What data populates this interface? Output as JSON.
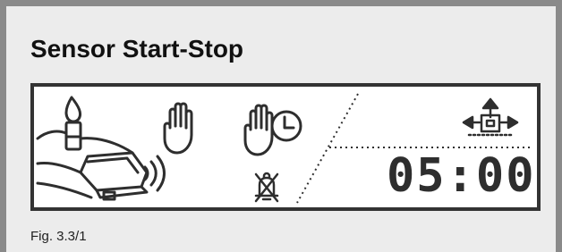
{
  "figure": {
    "title": "Sensor Start-Stop",
    "caption": "Fig. 3.3/1"
  },
  "display": {
    "timer_value": "05:00",
    "icons": [
      "hand-on-device-icon",
      "proximity-waves-icon",
      "hand-icon",
      "hand-timer-icon",
      "no-bell-icon",
      "move-arrows-icon"
    ]
  },
  "colors": {
    "frame": "#8a8a8a",
    "background": "#ececec",
    "lcd_background": "#ffffff",
    "lcd_ink": "#2e2e2e"
  }
}
